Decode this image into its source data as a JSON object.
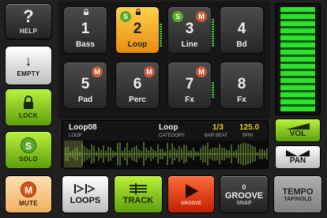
{
  "side": {
    "help": "HELP",
    "empty": "EMPTY",
    "lock": "LOCK",
    "solo": "SOLO",
    "solo_letter": "S",
    "mute": "MUTE",
    "mute_letter": "M"
  },
  "pads": [
    {
      "number": "1",
      "name": "Bass",
      "locked": true
    },
    {
      "number": "2",
      "name": "Loop",
      "selected": true,
      "badges": [
        "S"
      ],
      "locked": true
    },
    {
      "number": "3",
      "name": "Line",
      "badges": [
        "S",
        "M"
      ]
    },
    {
      "number": "4",
      "name": "Bd"
    },
    {
      "number": "5",
      "name": "Pad",
      "badges": [
        "M"
      ]
    },
    {
      "number": "6",
      "name": "Perc",
      "badges": [
        "M"
      ]
    },
    {
      "number": "7",
      "name": "Fx",
      "badges": [
        "M"
      ]
    },
    {
      "number": "8",
      "name": "Fx"
    }
  ],
  "info": {
    "loop_name": "Loop08",
    "loop_label": "LOOP",
    "category": "Loop",
    "category_label": "CATEGORY",
    "bar_beat": "1/3",
    "bar_beat_label": "BAR BEAT",
    "bpm": "125.0",
    "bpm_label": "BPM"
  },
  "right": {
    "vol": "VOL",
    "pan": "PAN",
    "tempo": "TEMPO",
    "tap_hold": "TAP/HOLD"
  },
  "bottom": {
    "loops": "LOOPS",
    "track": "TRACK",
    "groove_play": "GROOVE",
    "groove_snap_value": "0",
    "groove_snap_title": "GROOVE",
    "groove_snap_label": "SNAP"
  },
  "colors": {
    "accent_green": "#7ec820",
    "accent_orange": "#f0a020",
    "accent_red": "#e03010"
  }
}
